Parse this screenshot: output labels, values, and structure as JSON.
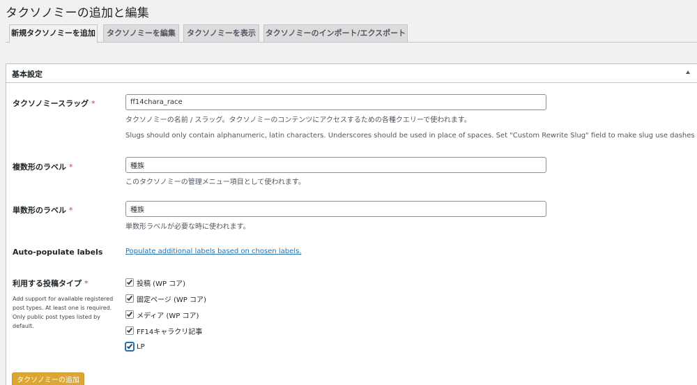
{
  "page": {
    "title": "タクソノミーの追加と編集"
  },
  "tabs": [
    {
      "label": "新規タクソノミーを追加"
    },
    {
      "label": "タクソノミーを編集"
    },
    {
      "label": "タクソノミーを表示"
    },
    {
      "label": "タクソノミーのインポート/エクスポート"
    }
  ],
  "panel": {
    "title": "基本設定",
    "toggle_icon": "arrow-up-icon"
  },
  "fields": {
    "slug": {
      "label": "タクソノミースラッグ",
      "required": "*",
      "value": "ff14chara_race",
      "desc": "タクソノミーの名前 / スラッグ。タクソノミーのコンテンツにアクセスするための各種クエリーで使われます。",
      "note": "Slugs should only contain alphanumeric, latin characters. Underscores should be used in place of spaces. Set \"Custom Rewrite Slug\" field to make slug use dashes for URLs."
    },
    "plural": {
      "label": "複数形のラベル",
      "required": "*",
      "value": "種族",
      "desc": "このタクソノミーの管理メニュー項目として使われます。"
    },
    "singular": {
      "label": "単数形のラベル",
      "required": "*",
      "value": "種族",
      "desc": "単数形ラベルが必要な時に使われます。"
    },
    "auto_populate": {
      "label": "Auto-populate labels",
      "link": "Populate additional labels based on chosen labels."
    },
    "post_types": {
      "label": "利用する投稿タイプ",
      "required": "*",
      "help": "Add support for available registered post types. At least one is required. Only public post types listed by default.",
      "options": [
        {
          "label": "投稿 (WP コア)",
          "checked": true
        },
        {
          "label": "固定ページ (WP コア)",
          "checked": true
        },
        {
          "label": "メディア (WP コア)",
          "checked": true
        },
        {
          "label": "FF14キャラクリ記事",
          "checked": true
        },
        {
          "label": "LP",
          "checked": true
        }
      ]
    }
  },
  "submit": {
    "label": "タクソノミーの追加"
  },
  "colors": {
    "accent": "#2271b1",
    "button": "#dba633",
    "required": "#d63638"
  }
}
